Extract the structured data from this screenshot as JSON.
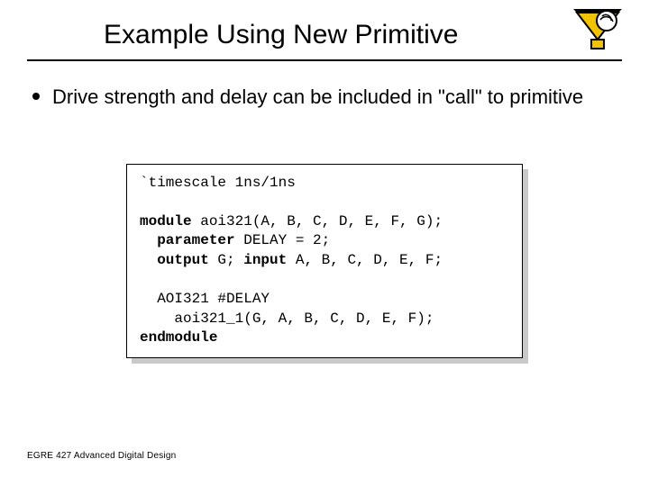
{
  "title": "Example Using New Primitive",
  "bullet": "Drive strength and delay can be included in \"call\" to primitive",
  "code": {
    "l1": "`timescale 1ns/1ns",
    "l2": "",
    "l3a": "module",
    "l3b": " aoi321(A, B, C, D, E, F, G);",
    "l4a": "  parameter",
    "l4b": " DELAY = 2;",
    "l5a": "  output",
    "l5b": " G; ",
    "l5c": "input",
    "l5d": " A, B, C, D, E, F;",
    "l6": "",
    "l7": "  AOI321 #DELAY",
    "l8": "    aoi321_1(G, A, B, C, D, E, F);",
    "l9": "endmodule"
  },
  "footer": "EGRE 427 Advanced Digital Design"
}
